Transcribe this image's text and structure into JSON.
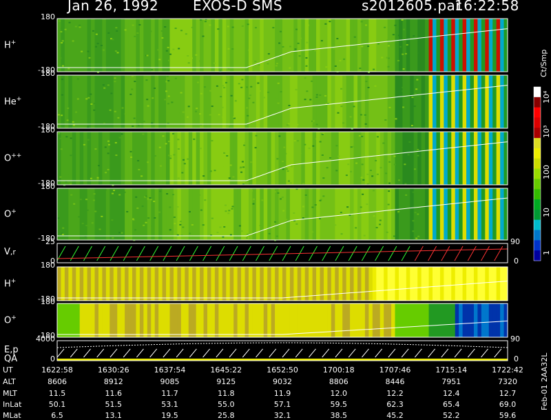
{
  "header": {
    "date": "Jan 26, 1992",
    "instrument": "EXOS-D SMS",
    "file": "s2012605.par",
    "time": "16:22:58"
  },
  "colors": {
    "scale": [
      "#0000a0",
      "#0033cc",
      "#0077cc",
      "#00bbcc",
      "#009933",
      "#00aa22",
      "#33bb00",
      "#66cc00",
      "#99dd00",
      "#ccdd00",
      "#eeee00",
      "#dddd22",
      "#aa0000",
      "#dd0000",
      "#ff0000",
      "#880000",
      "#ffffff"
    ],
    "trace": "#ffffff",
    "vr_green": "#33ff33",
    "vr_red": "#ff3333"
  },
  "chart_data": {
    "type": "heatmap",
    "panels": [
      {
        "label": "H",
        "sup": "+",
        "ytop": "180",
        "ybot": "-180",
        "style": "green-stripes"
      },
      {
        "label": "He",
        "sup": "+",
        "ytop": "180",
        "ybot": "-180",
        "style": "green-stripes"
      },
      {
        "label": "O",
        "sup": "++",
        "ytop": "180",
        "ybot": "-180",
        "style": "green-stripes"
      },
      {
        "label": "O",
        "sup": "+",
        "ytop": "180",
        "ybot": "-180",
        "style": "green-stripes"
      },
      {
        "label": "V",
        "sub": ",r",
        "ytop": "25",
        "ybot": "0",
        "right": "90",
        "right_bot": "0",
        "style": "vr"
      },
      {
        "label": "H",
        "sup": "+",
        "ytop": "180",
        "ybot": "-180",
        "style": "yellow"
      },
      {
        "label": "O",
        "sup": "+",
        "ytop": "180",
        "ybot": "-180",
        "style": "yellow-blue"
      },
      {
        "label": "E,p",
        "label2": "QA",
        "ytop": "4000",
        "ybot": "0",
        "right": "90",
        "right_bot": "0",
        "style": "ep"
      }
    ],
    "colorbar": {
      "unit": "Ct/Smp",
      "ticks": [
        "10⁴",
        "10³",
        "100",
        "10",
        "1"
      ]
    },
    "side_note": "Feb-01 2AA32L",
    "table": {
      "rows": [
        {
          "label": "UT",
          "values": [
            "1622:58",
            "1630:26",
            "1637:54",
            "1645:22",
            "1652:50",
            "1700:18",
            "1707:46",
            "1715:14",
            "1722:42"
          ]
        },
        {
          "label": "ALT",
          "values": [
            "8606",
            "8912",
            "9085",
            "9125",
            "9032",
            "8806",
            "8446",
            "7951",
            "7320"
          ]
        },
        {
          "label": "MLT",
          "values": [
            "11.5",
            "11.6",
            "11.7",
            "11.8",
            "11.9",
            "12.0",
            "12.2",
            "12.4",
            "12.7"
          ]
        },
        {
          "label": "InLat",
          "values": [
            "50.1",
            "51.5",
            "53.1",
            "55.0",
            "57.1",
            "59.5",
            "62.3",
            "65.4",
            "69.0"
          ]
        },
        {
          "label": "MLat",
          "values": [
            "6.5",
            "13.1",
            "19.5",
            "25.8",
            "32.1",
            "38.5",
            "45.2",
            "52.2",
            "59.6"
          ]
        }
      ]
    }
  }
}
